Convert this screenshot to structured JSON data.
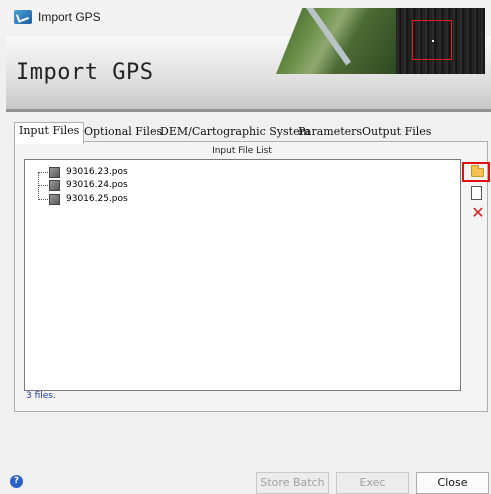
{
  "window": {
    "title": "Import GPS",
    "icon": "app-icon",
    "controls": {
      "minimize": "—",
      "maximize": "☐",
      "close": "✕"
    }
  },
  "banner": {
    "title": "Import GPS"
  },
  "tabs": [
    {
      "label": "Input Files",
      "active": true
    },
    {
      "label": "Optional Files",
      "active": false
    },
    {
      "label": "DEM/Cartographic System",
      "active": false
    },
    {
      "label": "Parameters",
      "active": false
    },
    {
      "label": "Output Files",
      "active": false
    }
  ],
  "input_files": {
    "list_header": "Input File List",
    "files": [
      "93016.23.pos",
      "93016.24.pos",
      "93016.25.pos"
    ],
    "count_text": "3 files.",
    "side_buttons": {
      "open": "folder-open-icon",
      "new": "new-document-icon",
      "delete": "delete-icon"
    }
  },
  "footer": {
    "help_glyph": "?",
    "store_batch": "Store Batch",
    "exec": "Exec",
    "close": "Close"
  },
  "colors": {
    "highlight": "#e01010",
    "delete": "#d22020",
    "folder": "#f2c14e",
    "count_text": "#1a3a9a"
  }
}
